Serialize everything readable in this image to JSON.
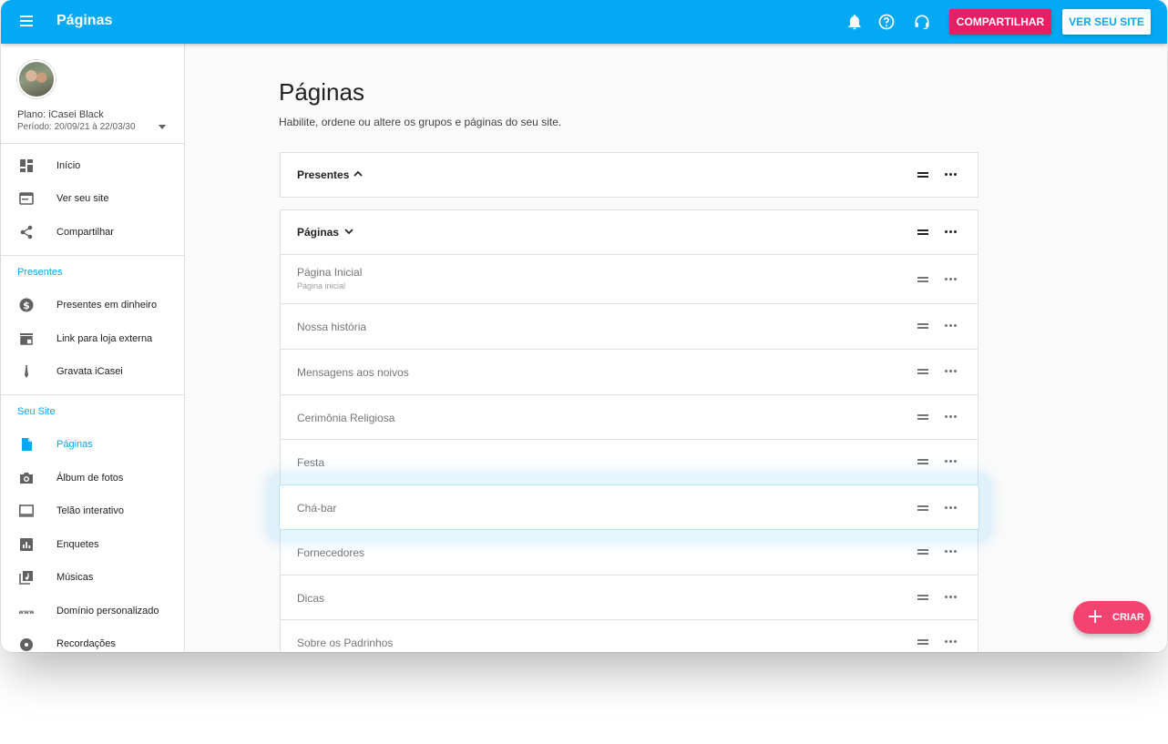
{
  "header": {
    "title": "Páginas",
    "share_label": "COMPARTILHAR",
    "view_site_label": "VER SEU SITE",
    "icons": [
      "bell-icon",
      "help-icon",
      "support-icon"
    ],
    "accent_color": "#03a9f4",
    "share_color": "#e91e63"
  },
  "sidebar": {
    "plan": "Plano: iCasei Black",
    "period": "Período: 20/09/21 à 22/03/30",
    "top_items": [
      {
        "label": "Início",
        "icon": "dashboard-icon"
      },
      {
        "label": "Ver seu site",
        "icon": "browser-icon"
      },
      {
        "label": "Compartilhar",
        "icon": "share-icon"
      }
    ],
    "sections": [
      {
        "title": "Presentes",
        "items": [
          {
            "label": "Presentes em dinheiro",
            "icon": "money-icon"
          },
          {
            "label": "Link para loja externa",
            "icon": "store-icon"
          },
          {
            "label": "Gravata iCasei",
            "icon": "tie-icon"
          }
        ]
      },
      {
        "title": "Seu Site",
        "items": [
          {
            "label": "Páginas",
            "icon": "page-icon",
            "active": true
          },
          {
            "label": "Álbum de fotos",
            "icon": "camera-icon"
          },
          {
            "label": "Telão interativo",
            "icon": "monitor-icon"
          },
          {
            "label": "Enquetes",
            "icon": "poll-icon"
          },
          {
            "label": "Músicas",
            "icon": "music-icon"
          },
          {
            "label": "Domínio personalizado",
            "icon": "www-icon"
          },
          {
            "label": "Recordações",
            "icon": "disc-icon"
          }
        ]
      }
    ]
  },
  "main": {
    "title": "Páginas",
    "subtitle": "Habilite, ordene ou altere os grupos e páginas do seu site.",
    "groups": [
      {
        "label": "Presentes",
        "expanded": true
      },
      {
        "label": "Páginas",
        "expanded": false
      }
    ],
    "pages": [
      {
        "label": "Página Inicial",
        "sub": "Página inicial"
      },
      {
        "label": "Nossa história"
      },
      {
        "label": "Mensagens aos noivos"
      },
      {
        "label": "Cerimônia Religiosa"
      },
      {
        "label": "Festa"
      },
      {
        "label": "Fornecedores"
      },
      {
        "label": "Dicas"
      },
      {
        "label": "Sobre os Padrinhos"
      }
    ],
    "dragging_item": "Chá-bar"
  },
  "fab": {
    "label": "CRIAR",
    "color": "#f44271"
  }
}
